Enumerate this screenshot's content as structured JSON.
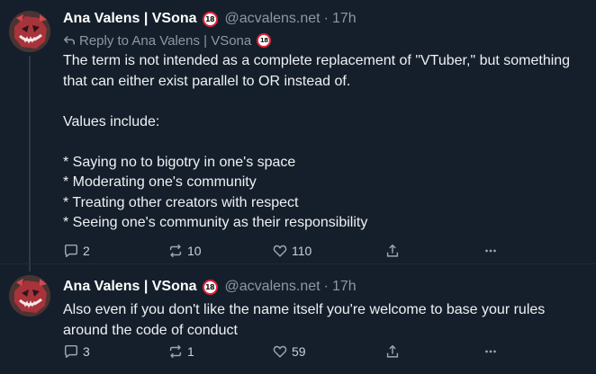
{
  "posts": [
    {
      "author": "Ana Valens | VSona",
      "badge": "18",
      "handle": "@acvalens.net",
      "dot": "·",
      "time": "17h",
      "reply_to_label": "Reply to Ana Valens | VSona",
      "reply_to_badge": "18",
      "paragraphs": [
        "The term is not intended as a complete replacement of \"VTuber,\" but something that can either exist parallel to OR instead of.",
        "Values include:",
        "* Saying no to bigotry in one's space\n* Moderating one's community\n* Treating other creators with respect\n* Seeing one's community as their responsibility"
      ],
      "counts": {
        "replies": "2",
        "reposts": "10",
        "likes": "110"
      }
    },
    {
      "author": "Ana Valens | VSona",
      "badge": "18",
      "handle": "@acvalens.net",
      "dot": "·",
      "time": "17h",
      "paragraphs": [
        "Also even if you don't like the name itself you're welcome to base your rules around the code of conduct"
      ],
      "counts": {
        "replies": "3",
        "reposts": "1",
        "likes": "59"
      }
    }
  ],
  "icons": {
    "reply": "reply-arrow-icon",
    "comment": "speech-bubble-icon",
    "repost": "repost-arrows-icon",
    "like": "heart-icon",
    "share": "share-upload-icon",
    "more": "more-dots-icon"
  },
  "colors": {
    "background": "#151f2b",
    "text": "#eef1f4",
    "muted": "#8b98a5",
    "badge_ring": "#e0243a"
  }
}
